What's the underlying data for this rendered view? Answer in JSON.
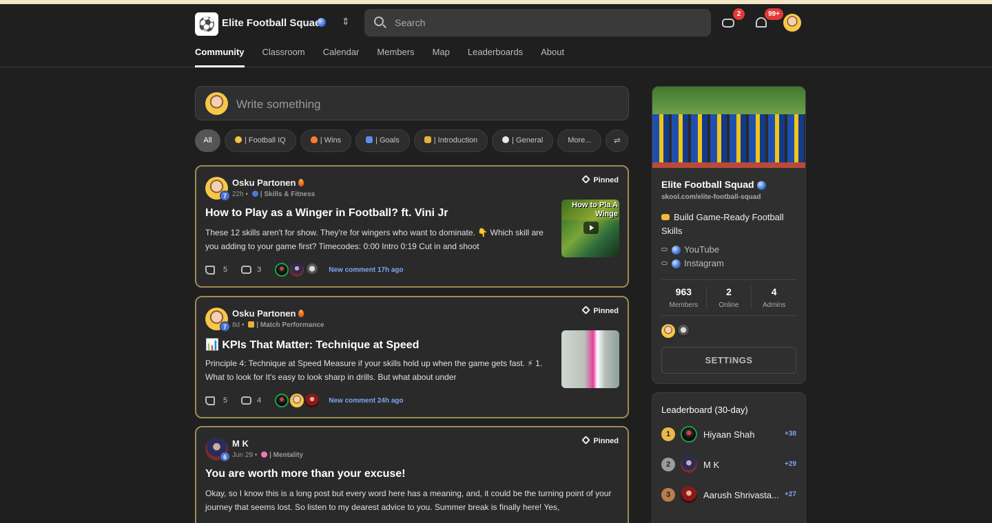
{
  "header": {
    "app_title": "Elite Football Squad",
    "search_placeholder": "Search",
    "chat_badge": "2",
    "notif_badge": "99+"
  },
  "tabs": [
    "Community",
    "Classroom",
    "Calendar",
    "Members",
    "Map",
    "Leaderboards",
    "About"
  ],
  "composer": {
    "placeholder": "Write something"
  },
  "filters": [
    "All",
    "| Football IQ",
    "| Wins",
    "| Goals",
    "| Introduction",
    "| General",
    "More..."
  ],
  "filter_icon_colors": [
    "",
    "#f4c542",
    "#ff7a2a",
    "#5b8def",
    "#e8b13a",
    "#e8e8e8",
    ""
  ],
  "posts": [
    {
      "author": "Osku Partonen",
      "level": "7",
      "time": "22h",
      "category": "| Skills & Fitness",
      "pinned": "Pinned",
      "title": "How to Play as a Winger in Football? ft. Vini Jr",
      "body": "These 12 skills aren't for show. They're for wingers who want to dominate. 👇 Which skill are you adding to your game first? Timecodes: 0:00 Intro 0:19 Cut in and shoot",
      "thumb_text": "How to Pla A Winge",
      "likes": "5",
      "comments": "3",
      "new_comment": "New comment 17h ago"
    },
    {
      "author": "Osku Partonen",
      "level": "7",
      "time": "8d",
      "category": "| Match Performance",
      "pinned": "Pinned",
      "title": "📊 KPIs That Matter: Technique at Speed",
      "body": "Principle 4: Technique at Speed Measure if your skills hold up when the game gets fast. ⚡ 1. What to look for It's easy to look sharp in drills. But what about under",
      "likes": "5",
      "comments": "4",
      "new_comment": "New comment 24h ago"
    },
    {
      "author": "M K",
      "level": "6",
      "time": "Jun 29",
      "category": "| Mentality",
      "pinned": "Pinned",
      "title": "You are worth more than your excuse!",
      "body": "Okay, so I know this is a long post but every word here has a meaning, and, it could be the turning point of your journey that seems lost. So listen to my dearest advice to you. Summer break is finally here! Yes,"
    }
  ],
  "sidebar": {
    "title": "Elite Football Squad",
    "url": "skool.com/elite-football-squad",
    "tagline": "Build Game-Ready Football Skills",
    "links": [
      "YouTube",
      "Instagram"
    ],
    "stats": [
      {
        "value": "963",
        "label": "Members"
      },
      {
        "value": "2",
        "label": "Online"
      },
      {
        "value": "4",
        "label": "Admins"
      }
    ],
    "settings_label": "SETTINGS"
  },
  "leaderboard": {
    "title": "Leaderboard (30-day)",
    "rows": [
      {
        "rank": "1",
        "name": "Hiyaan Shah",
        "points": "+38"
      },
      {
        "rank": "2",
        "name": "M K",
        "points": "+29"
      },
      {
        "rank": "3",
        "name": "Aarush Shrivasta...",
        "points": "+27"
      }
    ]
  }
}
